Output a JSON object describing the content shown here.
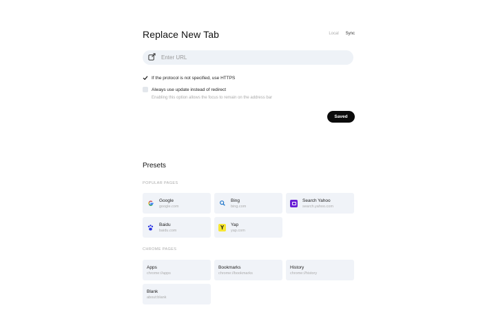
{
  "header": {
    "title": "Replace New Tab",
    "mode_local": "Local",
    "mode_sync": "Sync"
  },
  "url_input": {
    "placeholder": "Enter URL",
    "value": "",
    "icon": "edit-link-icon"
  },
  "options": [
    {
      "label": "If the protocol is not specified, use HTTPS",
      "checked": true
    },
    {
      "label": "Always use update instead of redirect",
      "checked": false,
      "hint": "Enabling this option allows the focus to remain on the address bar"
    }
  ],
  "saved_label": "Saved",
  "presets": {
    "title": "Presets",
    "popular_label": "POPULAR PAGES",
    "popular": [
      {
        "name": "Google",
        "url": "google.com",
        "icon": "google-icon"
      },
      {
        "name": "Bing",
        "url": "bing.com",
        "icon": "bing-search-icon"
      },
      {
        "name": "Search Yahoo",
        "url": "search.yahoo.com",
        "icon": "yahoo-icon"
      },
      {
        "name": "Baidu",
        "url": "baidu.com",
        "icon": "baidu-paw-icon"
      },
      {
        "name": "Yap",
        "url": "yap.com",
        "icon": "yap-icon",
        "icon_glyph": "Y"
      }
    ],
    "chrome_label": "CHROME PAGES",
    "chrome": [
      {
        "name": "Apps",
        "url": "chrome://apps"
      },
      {
        "name": "Bookmarks",
        "url": "chrome://bookmarks"
      },
      {
        "name": "History",
        "url": "chrome://history"
      },
      {
        "name": "Blank",
        "url": "about:blank"
      }
    ]
  },
  "colors": {
    "accent_dark": "#0b0b0b",
    "card_bg": "#f0f3f8",
    "yahoo": "#6a1fd6",
    "yap": "#f7e633",
    "bing": "#1a73c9"
  }
}
